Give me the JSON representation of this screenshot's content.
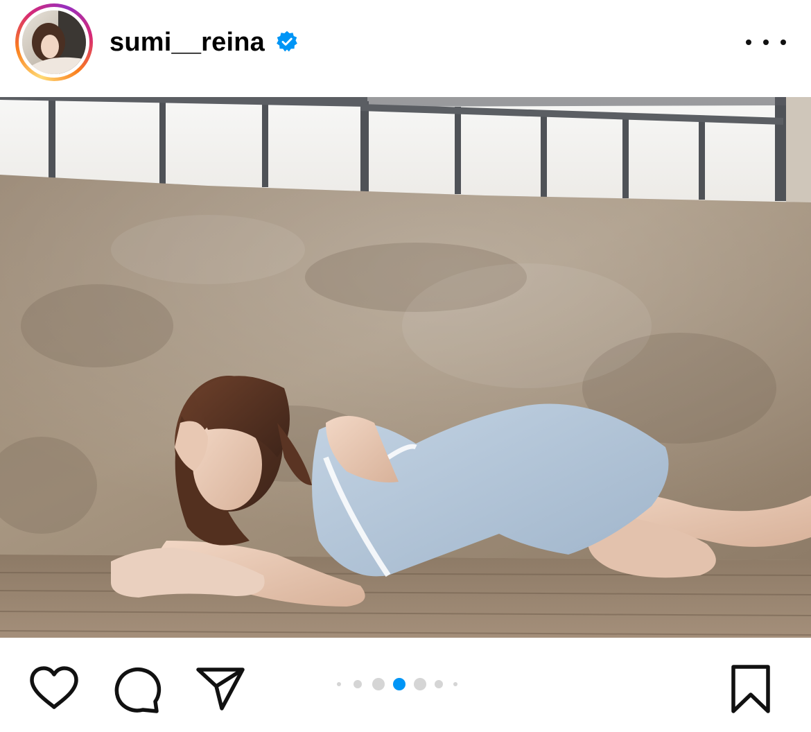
{
  "post": {
    "username": "sumi__reina",
    "verified": true
  },
  "icons": {
    "avatar": "avatar-image",
    "verified": "verified-badge-icon",
    "more": "more-options-icon",
    "like": "heart-icon",
    "comment": "comment-bubble-icon",
    "share": "paper-plane-icon",
    "save": "bookmark-icon"
  },
  "carousel": {
    "total_dots": 7,
    "active_index": 4
  },
  "colors": {
    "verified_blue": "#0095f6",
    "active_dot": "#0095f6",
    "inactive_dot": "#d5d5d5",
    "ring_gradient": [
      "#feda75",
      "#fa7e1e",
      "#d62976",
      "#962fbf"
    ]
  }
}
